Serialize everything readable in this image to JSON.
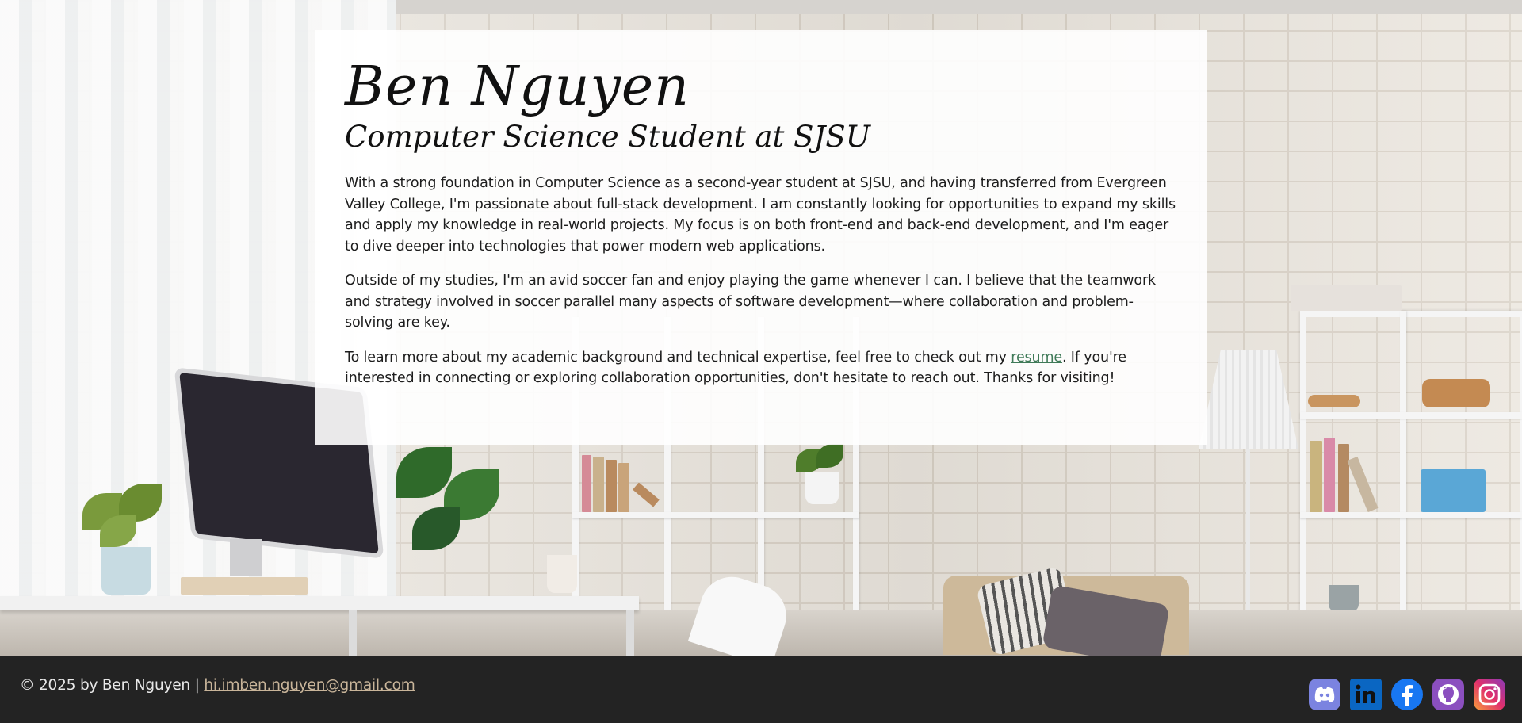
{
  "profile": {
    "name": "Ben Nguyen",
    "title": "Computer Science Student at SJSU"
  },
  "about": {
    "paragraph1": "With a strong foundation in Computer Science as a second-year student at SJSU, and having transferred from Evergreen Valley College, I'm passionate about full-stack development. I am constantly looking for opportunities to expand my skills and apply my knowledge in real-world projects. My focus is on both front-end and back-end development, and I'm eager to dive deeper into technologies that power modern web applications.",
    "paragraph2": "Outside of my studies, I'm an avid soccer fan and enjoy playing the game whenever I can. I believe that the teamwork and strategy involved in soccer parallel many aspects of software development—where collaboration and problem-solving are key.",
    "paragraph3_before": "To learn more about my academic background and technical expertise, feel free to check out my ",
    "resume_link": "resume",
    "paragraph3_after": ". If you're interested in connecting or exploring collaboration opportunities, don't hesitate to reach out. Thanks for visiting!"
  },
  "footer": {
    "copyright": "© 2025 by Ben Nguyen | ",
    "email": "hi.imben.nguyen@gmail.com",
    "socials": [
      {
        "icon": "discord-icon",
        "color": "#7b83e0"
      },
      {
        "icon": "linkedin-icon",
        "color": "#0a66c2"
      },
      {
        "icon": "facebook-icon",
        "color": "#1877f2"
      },
      {
        "icon": "github-icon",
        "color": "#8b4fbf"
      },
      {
        "icon": "instagram-icon",
        "color": "#e1306c"
      }
    ]
  },
  "colors": {
    "link": "#3f7a58",
    "footer_bg": "#232323",
    "email_link": "#c9b59a"
  }
}
